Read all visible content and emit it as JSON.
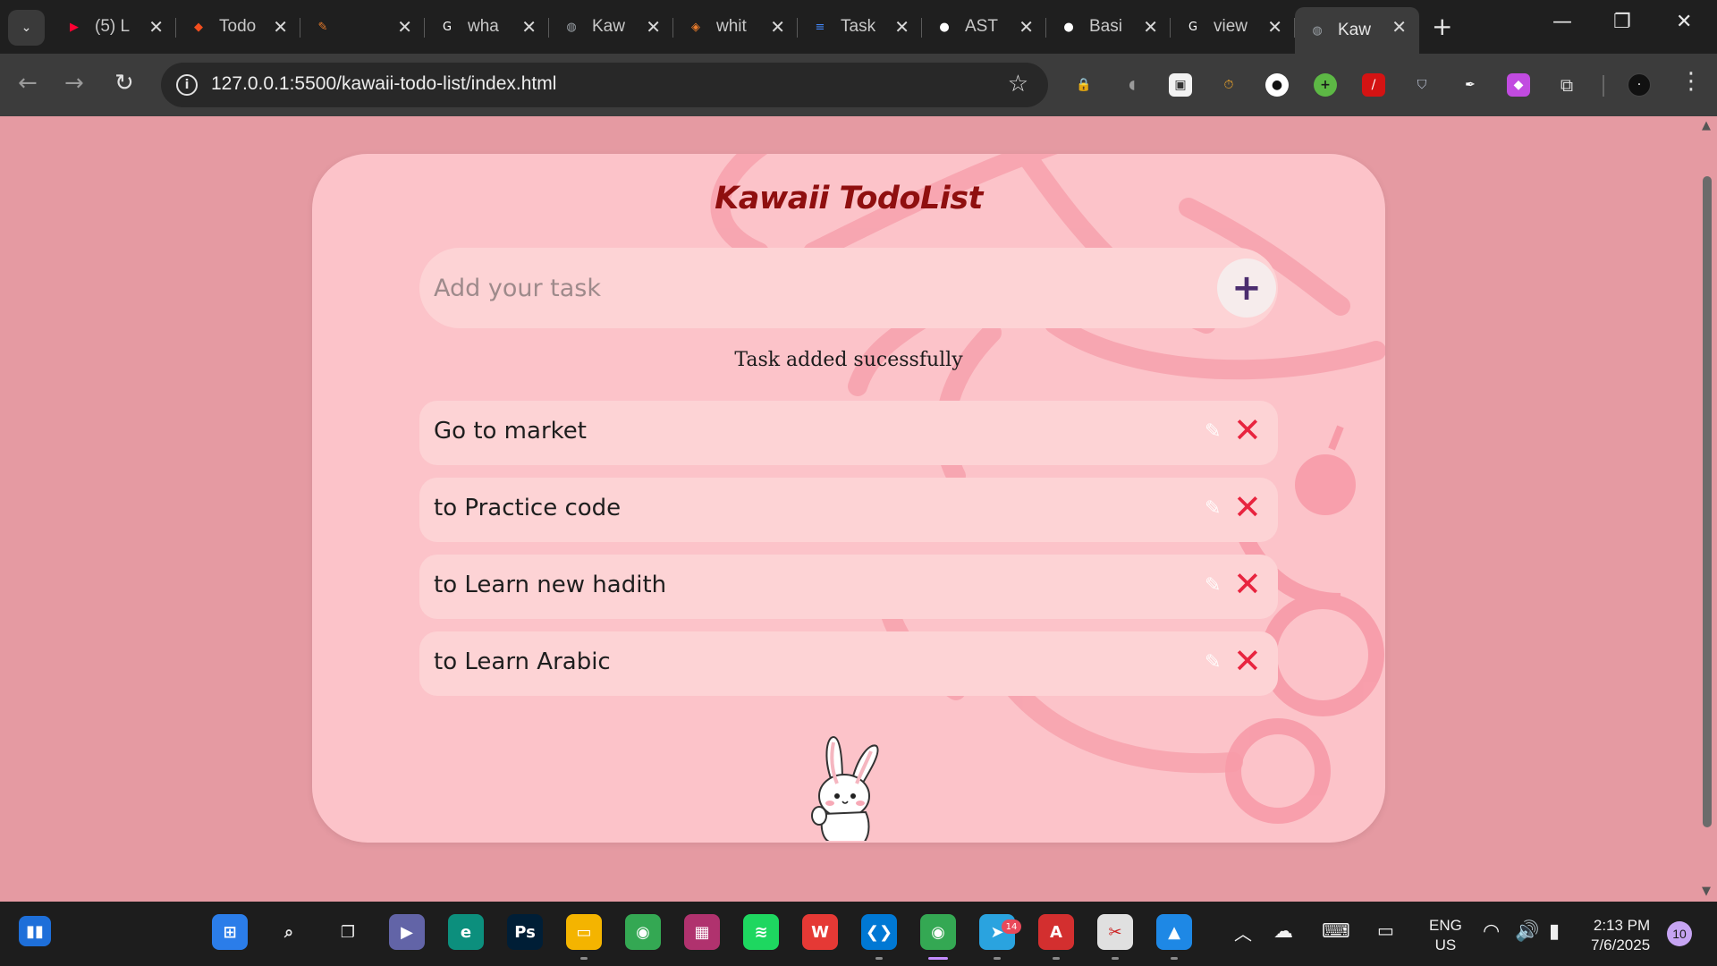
{
  "browser": {
    "tabs": [
      {
        "title": "(5) L",
        "icon": "youtube-icon",
        "color": "#ff0033",
        "glyph": "▶"
      },
      {
        "title": "Todo",
        "icon": "figma-icon",
        "color": "#f24e1e",
        "glyph": "◆"
      },
      {
        "title": "",
        "icon": "pen-icon",
        "color": "#e87b2b",
        "glyph": "✎"
      },
      {
        "title": "wha",
        "icon": "google-icon",
        "color": "#ffffff",
        "glyph": "G"
      },
      {
        "title": "Kaw",
        "icon": "globe-icon",
        "color": "#9aa0a6",
        "glyph": "◍"
      },
      {
        "title": "whit",
        "icon": "html-icon",
        "color": "#e87b2b",
        "glyph": "◈"
      },
      {
        "title": "Task",
        "icon": "docs-icon",
        "color": "#4285f4",
        "glyph": "≡"
      },
      {
        "title": "AST",
        "icon": "github-icon",
        "color": "#ffffff",
        "glyph": "●"
      },
      {
        "title": "Basi",
        "icon": "github-icon",
        "color": "#ffffff",
        "glyph": "●"
      },
      {
        "title": "view",
        "icon": "google-icon",
        "color": "#ffffff",
        "glyph": "G"
      },
      {
        "title": "Kaw",
        "icon": "globe-icon",
        "color": "#9aa0a6",
        "glyph": "◍",
        "active": true
      }
    ],
    "url": "127.0.0.1:5500/kawaii-todo-list/index.html"
  },
  "app": {
    "title": "Kawaii TodoList",
    "input_placeholder": "Add your task",
    "add_glyph": "+",
    "status": "Task added sucessfully",
    "tasks": [
      {
        "text": "Go to market"
      },
      {
        "text": "to Practice code"
      },
      {
        "text": "to Learn new hadith"
      },
      {
        "text": "to Learn Arabic"
      }
    ],
    "colors": {
      "title": "#8f0f0f",
      "delete": "#e8243f",
      "card": "#fcc3c9",
      "page": "#e59aa2"
    }
  },
  "taskbar": {
    "apps": [
      {
        "icon": "windows-start-icon",
        "color": "#2b7de9",
        "glyph": "⊞"
      },
      {
        "icon": "search-icon",
        "color": "transparent",
        "glyph": "⌕"
      },
      {
        "icon": "task-view-icon",
        "color": "transparent",
        "glyph": "❐"
      },
      {
        "icon": "teams-icon",
        "color": "#6264a7",
        "glyph": "▶"
      },
      {
        "icon": "edge-icon",
        "color": "#0c8f7d",
        "glyph": "e"
      },
      {
        "icon": "photoshop-icon",
        "color": "#001e36",
        "glyph": "Ps"
      },
      {
        "icon": "file-explorer-icon",
        "color": "#f4b400",
        "glyph": "▭"
      },
      {
        "icon": "chrome-icon",
        "color": "#34a853",
        "glyph": "◉"
      },
      {
        "icon": "winrar-icon",
        "color": "#b0326e",
        "glyph": "▦"
      },
      {
        "icon": "spotify-icon",
        "color": "#1ed760",
        "glyph": "≋"
      },
      {
        "icon": "wps-icon",
        "color": "#e53935",
        "glyph": "W"
      },
      {
        "icon": "vscode-icon",
        "color": "#0078d4",
        "glyph": "❮❯"
      },
      {
        "icon": "chrome-profile-icon",
        "color": "#34a853",
        "glyph": "◉"
      },
      {
        "icon": "telegram-icon",
        "color": "#2aa3df",
        "glyph": "➤"
      },
      {
        "icon": "acrobat-icon",
        "color": "#d32f2f",
        "glyph": "A"
      },
      {
        "icon": "snipping-tool-icon",
        "color": "#e0e0e0",
        "glyph": "✂"
      },
      {
        "icon": "photos-icon",
        "color": "#1e88e5",
        "glyph": "▲"
      }
    ],
    "telegram_badge": "14",
    "language_line1": "ENG",
    "language_line2": "US",
    "time": "2:13 PM",
    "date": "7/6/2025",
    "notifications": "10"
  }
}
